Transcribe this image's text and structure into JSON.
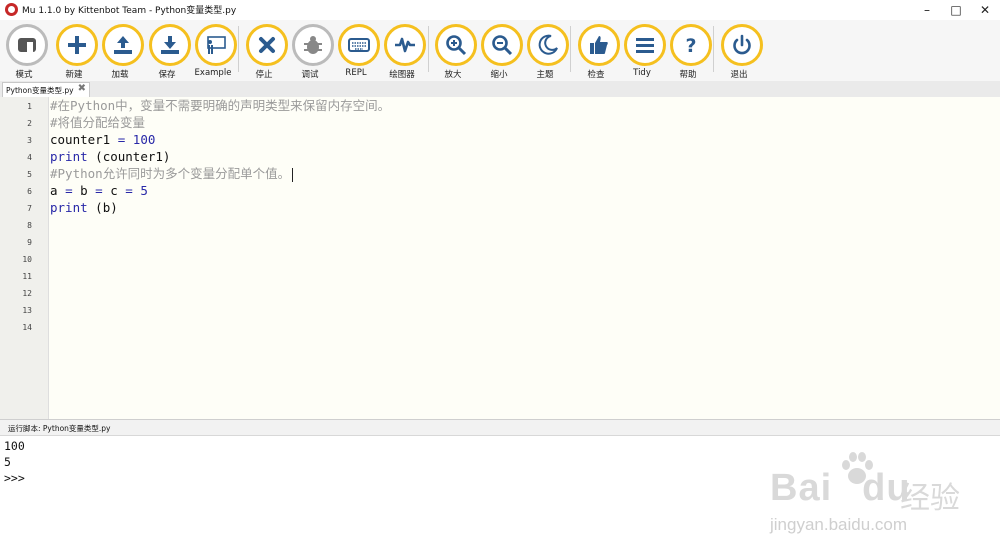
{
  "window": {
    "title": "Mu 1.1.0 by Kittenbot Team - Python变量类型.py",
    "minimize_icon": "minimize-icon",
    "maximize_icon": "maximize-icon",
    "close_icon": "close-icon"
  },
  "toolbar": {
    "buttons": [
      {
        "label": "模式",
        "icon": "mode-icon"
      },
      {
        "label": "新建",
        "icon": "plus-icon"
      },
      {
        "label": "加载",
        "icon": "upload-icon"
      },
      {
        "label": "保存",
        "icon": "download-icon"
      },
      {
        "label": "Example",
        "icon": "presentation-icon"
      },
      {
        "label": "停止",
        "icon": "stop-x-icon"
      },
      {
        "label": "调试",
        "icon": "bug-icon"
      },
      {
        "label": "REPL",
        "icon": "keyboard-icon"
      },
      {
        "label": "绘图器",
        "icon": "pulse-icon"
      },
      {
        "label": "放大",
        "icon": "zoom-in-icon"
      },
      {
        "label": "缩小",
        "icon": "zoom-out-icon"
      },
      {
        "label": "主题",
        "icon": "moon-icon"
      },
      {
        "label": "检查",
        "icon": "thumbs-up-icon"
      },
      {
        "label": "Tidy",
        "icon": "lines-icon"
      },
      {
        "label": "帮助",
        "icon": "question-icon"
      },
      {
        "label": "退出",
        "icon": "power-icon"
      }
    ]
  },
  "tab": {
    "label": "Python变量类型.py",
    "close": "✖"
  },
  "editor": {
    "line_numbers": [
      "1",
      "2",
      "3",
      "4",
      "5",
      "6",
      "7",
      "8",
      "9",
      "10",
      "11",
      "12",
      "13",
      "14"
    ],
    "lines": [
      {
        "parts": [
          {
            "t": "#在Python中，变量不需要明确的声明类型来保留内存空间。",
            "c": "cm"
          }
        ]
      },
      {
        "parts": [
          {
            "t": "#将值分配给变量",
            "c": "cm"
          }
        ]
      },
      {
        "parts": [
          {
            "t": "counter1 ",
            "c": ""
          },
          {
            "t": "=",
            "c": "op"
          },
          {
            "t": " ",
            "c": ""
          },
          {
            "t": "100",
            "c": "num"
          }
        ]
      },
      {
        "parts": [
          {
            "t": "print",
            "c": "kw"
          },
          {
            "t": " (counter1)",
            "c": ""
          }
        ]
      },
      {
        "parts": [
          {
            "t": "#Python允许同时为多个变量分配单个值。",
            "c": "cm"
          }
        ]
      },
      {
        "parts": [
          {
            "t": "a ",
            "c": ""
          },
          {
            "t": "=",
            "c": "op"
          },
          {
            "t": " b ",
            "c": ""
          },
          {
            "t": "=",
            "c": "op"
          },
          {
            "t": " c ",
            "c": ""
          },
          {
            "t": "=",
            "c": "op"
          },
          {
            "t": " ",
            "c": ""
          },
          {
            "t": "5",
            "c": "num"
          }
        ]
      },
      {
        "parts": [
          {
            "t": "print",
            "c": "kw"
          },
          {
            "t": " (b)",
            "c": ""
          }
        ]
      }
    ]
  },
  "run": {
    "label": "运行脚本: Python变量类型.py"
  },
  "output": {
    "lines": [
      "100",
      "5",
      ">>>"
    ]
  },
  "watermark": {
    "brand": "Bai",
    "brand2": "du",
    "cn": "经验",
    "url": "jingyan.baidu.com"
  },
  "colors": {
    "accent": "#f5c01f",
    "keyword": "#2828a8",
    "comment": "#9a9a9a",
    "editor_bg": "#fefef7"
  }
}
